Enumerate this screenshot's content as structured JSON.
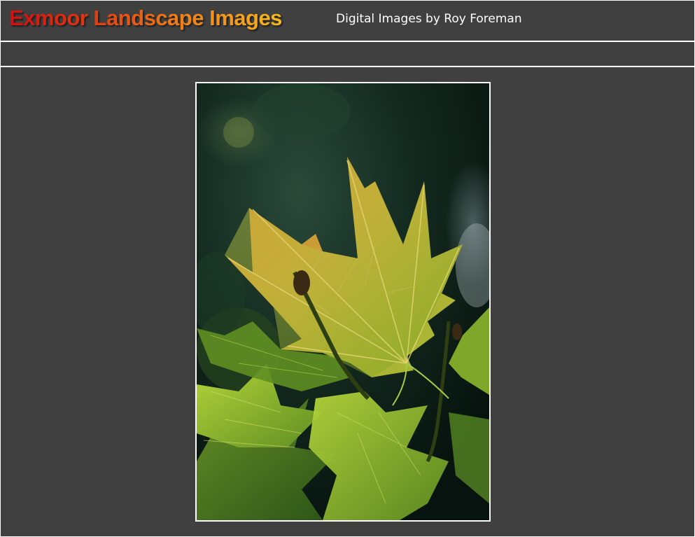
{
  "header": {
    "title": "Exmoor Landscape Images",
    "subtitle": "Digital Images by Roy Foreman"
  },
  "colors": {
    "background": "#404040",
    "rule": "#ffffff",
    "title_gradient_start": "#d10f0f",
    "title_gradient_end": "#f6b81c",
    "subtitle": "#ffffff"
  },
  "photo": {
    "subject": "backlit maple leaves against dark green background"
  }
}
